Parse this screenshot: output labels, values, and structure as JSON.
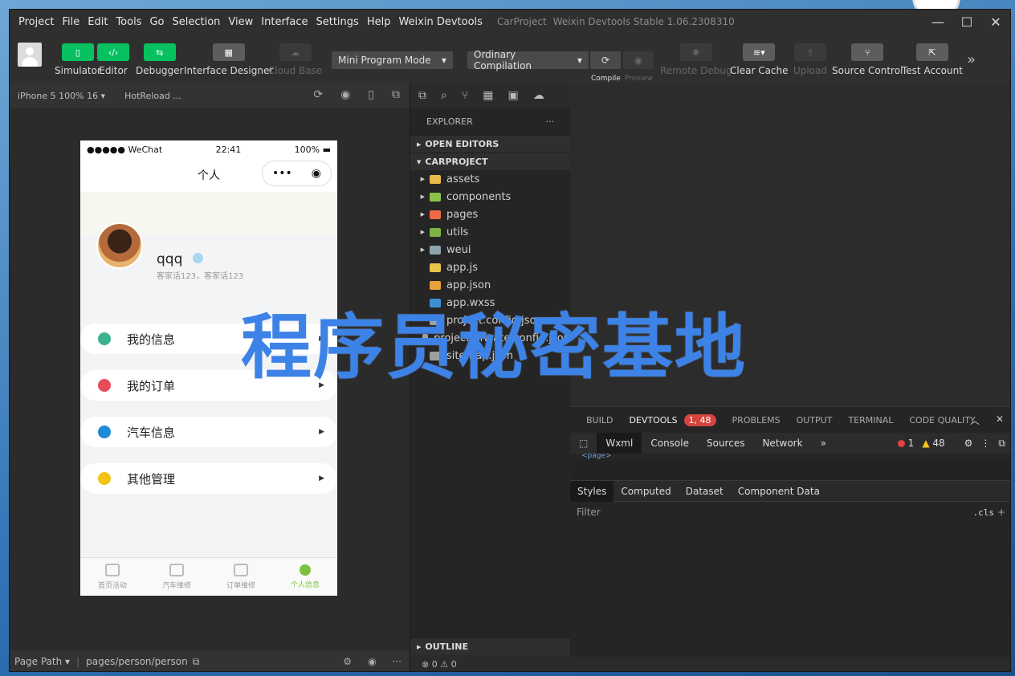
{
  "menu": {
    "items": [
      "Project",
      "File",
      "Edit",
      "Tools",
      "Go",
      "Selection",
      "View",
      "Interface",
      "Settings",
      "Help",
      "Weixin Devtools"
    ],
    "project_name": "CarProject",
    "app_title": "Weixin Devtools Stable 1.06.2308310"
  },
  "toolbar": {
    "simulator": "Simulator",
    "editor": "Editor",
    "debugger": "Debugger",
    "designer": "Interface Designer",
    "cloud": "Cloud Base",
    "mode": "Mini Program Mode",
    "compile_mode": "Ordinary Compilation",
    "compile": "Compile",
    "preview": "Preview",
    "remote_debug": "Remote Debug",
    "clear_cache": "Clear Cache",
    "upload": "Upload",
    "source_control": "Source Control",
    "test_account": "Test Account"
  },
  "simulator": {
    "device": "iPhone 5 100% 16 ▾",
    "hotreload": "HotReload ...",
    "page_path_label": "Page Path ▾",
    "page_path": "pages/person/person"
  },
  "phone": {
    "carrier": "●●●●● WeChat",
    "time": "22:41",
    "battery": "100%",
    "nav_title": "个人",
    "capsule_dots": "•••",
    "username": "qqq",
    "subtitle": "客家话123，客家话123",
    "menu": [
      {
        "label": "我的信息",
        "color": "#3bb28f"
      },
      {
        "label": "我的订单",
        "color": "#e84c5b"
      },
      {
        "label": "汽车信息",
        "color": "#1f8ad6"
      },
      {
        "label": "其他管理",
        "color": "#f2c318"
      }
    ],
    "tabs": [
      {
        "label": "首页活动",
        "active": false
      },
      {
        "label": "汽车维修",
        "active": false
      },
      {
        "label": "订单维修",
        "active": false
      },
      {
        "label": "个人信息",
        "active": true
      }
    ]
  },
  "explorer": {
    "title": "EXPLORER",
    "more": "···",
    "open_editors": "OPEN EDITORS",
    "project": "CARPROJECT",
    "tree": [
      {
        "name": "assets",
        "folder": true,
        "color": "#e9b949"
      },
      {
        "name": "components",
        "folder": true,
        "color": "#8bc34a"
      },
      {
        "name": "pages",
        "folder": true,
        "color": "#ef6a44"
      },
      {
        "name": "utils",
        "folder": true,
        "color": "#7cb342"
      },
      {
        "name": "weui",
        "folder": true,
        "color": "#90a4ae"
      },
      {
        "name": "app.js",
        "folder": false,
        "color": "#e6c34b"
      },
      {
        "name": "app.json",
        "folder": false,
        "color": "#e6a23c"
      },
      {
        "name": "app.wxss",
        "folder": false,
        "color": "#3d8fd6"
      },
      {
        "name": "project.config.json",
        "folder": false,
        "color": "#9e9e9e"
      },
      {
        "name": "project.private.config.json",
        "folder": false,
        "color": "#9e9e9e"
      },
      {
        "name": "sitemap.json",
        "folder": false,
        "color": "#9e9e9e"
      }
    ],
    "outline": "OUTLINE",
    "status": "⊗ 0 ⚠ 0"
  },
  "devtools": {
    "tabs": [
      "BUILD",
      "DEVTOOLS",
      "PROBLEMS",
      "OUTPUT",
      "TERMINAL",
      "CODE QUALITY"
    ],
    "badge": "1, 48",
    "sub_tabs": [
      "Wxml",
      "Console",
      "Sources",
      "Network"
    ],
    "errors": "1",
    "warnings": "48",
    "wxml_line": "<page>",
    "style_tabs": [
      "Styles",
      "Computed",
      "Dataset",
      "Component Data"
    ],
    "filter_placeholder": "Filter",
    "cls": ".cls"
  },
  "watermark": "程序员秘密基地"
}
